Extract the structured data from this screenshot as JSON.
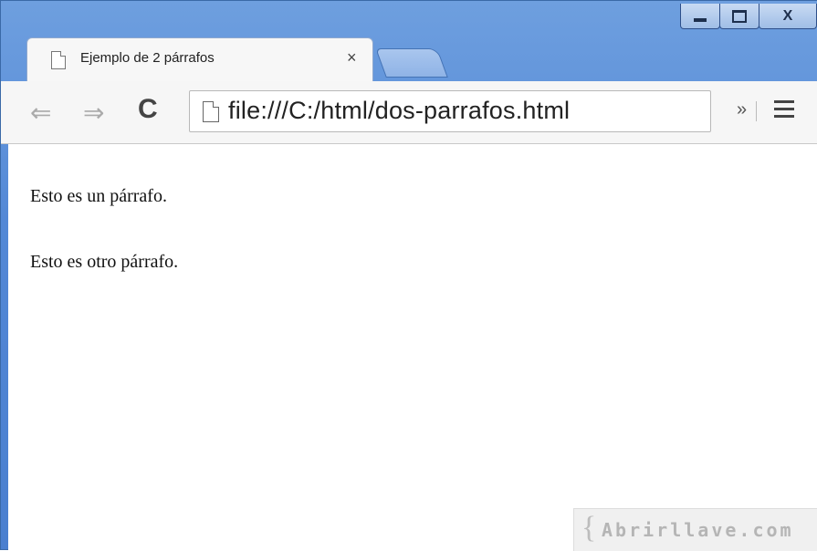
{
  "window": {
    "controls": [
      "minimize",
      "maximize",
      "close"
    ],
    "close_label": "X"
  },
  "tab": {
    "title": "Ejemplo de 2 párrafos",
    "close_label": "×"
  },
  "toolbar": {
    "back_label": "⇐",
    "forward_label": "⇒",
    "reload_label": "C",
    "url": "file:///C:/html/dos-parrafos.html",
    "more_label": "»"
  },
  "page": {
    "paragraphs": [
      "Esto es un párrafo.",
      "Esto es otro párrafo."
    ]
  },
  "watermark": {
    "text": "Abrirllave.com",
    "brace": "{"
  },
  "colors": {
    "frame": "#5388d6",
    "tab_bg": "#f7f7f7",
    "toolbar_bg": "#f6f6f6"
  }
}
